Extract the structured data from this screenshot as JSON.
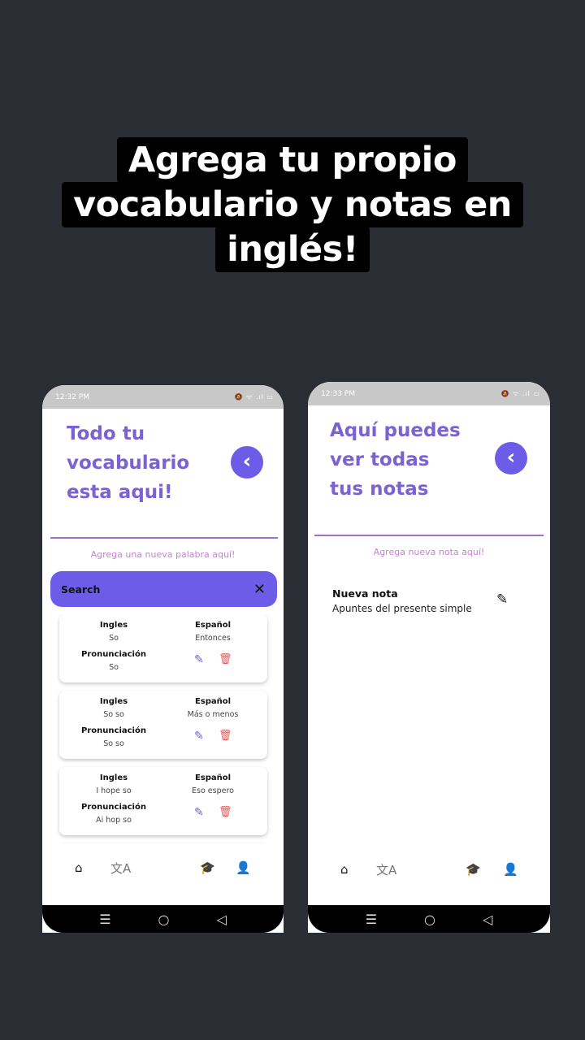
{
  "headline": {
    "line1": "Agrega tu propio",
    "line2": "vocabulario y notas en",
    "line3": "inglés!"
  },
  "phone1": {
    "status_time": "12:32 PM",
    "status_icons": "🔕 ᯤ .ıl ▭",
    "title_l1": "Todo tu",
    "title_l2": "vocabulario",
    "title_l3": "esta aqui!",
    "back": "‹",
    "add_link": "Agrega una nueva palabra aquí!",
    "search_label": "Search",
    "search_close": "✕",
    "label_ingles": "Ingles",
    "label_espanol": "Español",
    "label_pron": "Pronunciación",
    "cards": [
      {
        "ingles": "So",
        "espanol": "Entonces",
        "pron": "So"
      },
      {
        "ingles": "So so",
        "espanol": "Más o menos",
        "pron": "So so"
      },
      {
        "ingles": "I hope so",
        "espanol": "Eso espero",
        "pron": "Ai hop so"
      },
      {
        "ingles": "",
        "espanol": "",
        "pron": ""
      }
    ]
  },
  "phone2": {
    "status_time": "12:33 PM",
    "status_icons": "🔕 ᯤ .ıl ▭",
    "title_l1": "Aquí puedes",
    "title_l2": "ver todas",
    "title_l3": "tus notas",
    "back": "‹",
    "add_link": "Agrega nueva nota aquí!",
    "note_title": "Nueva nota",
    "note_body": "Apuntes del presente simple"
  },
  "icons": {
    "home": "home-icon",
    "translate": "translate-icon",
    "school": "school-icon",
    "profile": "person-icon",
    "edit": "pencil-icon",
    "delete": "trash-icon"
  },
  "colors": {
    "accent": "#6c5ce7",
    "title": "#7b62d3",
    "link": "#c482cf",
    "delete": "#e05a5a"
  }
}
